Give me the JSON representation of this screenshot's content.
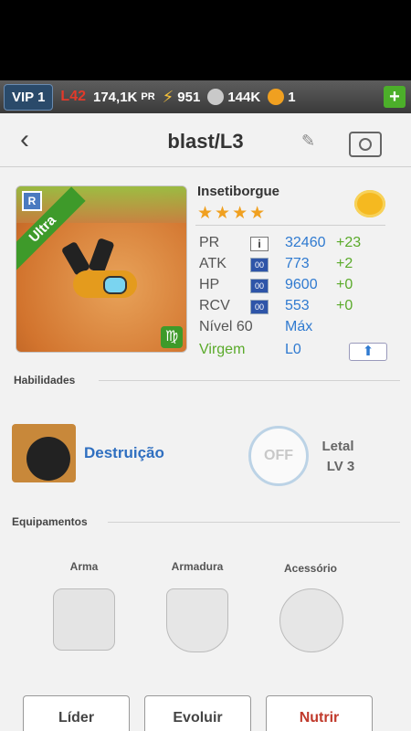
{
  "status_bar": {
    "vip": "VIP 1",
    "level": "L42",
    "power": "174,1K",
    "power_unit": "PR",
    "energy": "951",
    "resource": "144K",
    "coins": "1",
    "add": "+"
  },
  "header": {
    "title": "blast/L3",
    "icons": [
      "back-chevron-icon",
      "pencil-icon",
      "camera-icon"
    ]
  },
  "monster": {
    "rank_badge": "R",
    "rarity": "Ultra",
    "zodiac_symbol": "♍",
    "name": "Insetiborgue",
    "stars": "★★★★",
    "stats": [
      {
        "label": "PR",
        "value": "32460",
        "bonus": "+23"
      },
      {
        "label": "ATK",
        "value": "773",
        "bonus": "+2"
      },
      {
        "label": "HP",
        "value": "9600",
        "bonus": "+0"
      },
      {
        "label": "RCV",
        "value": "553",
        "bonus": "+0"
      }
    ],
    "level_label": "Nível 60",
    "level_value": "Máx",
    "sign_label": "Virgem",
    "sign_value": "L0",
    "stat_icon_text": "00",
    "info_icon_text": "i"
  },
  "skills": {
    "section_title": "Habilidades",
    "name": "Destruição",
    "toggle": "OFF",
    "type": "Letal",
    "level": "LV 3"
  },
  "equipment": {
    "section_title": "Equipamentos",
    "slots": [
      "Arma",
      "Armadura",
      "Acessório"
    ]
  },
  "actions": [
    "Líder",
    "Evoluir",
    "Nutrir"
  ],
  "colors": {
    "accent_blue": "#2f7ad0",
    "bonus_green": "#5aaa2a",
    "danger_red": "#c0392b"
  }
}
